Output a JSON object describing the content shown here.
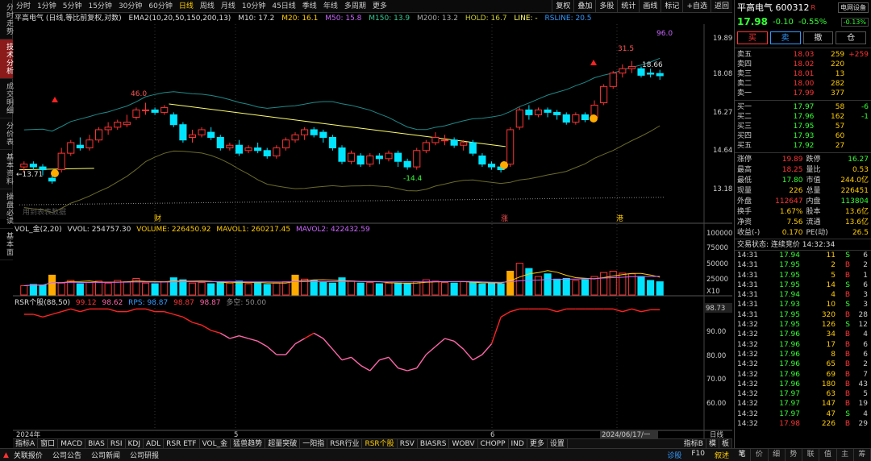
{
  "left_tabs": [
    "分时走势",
    "技术分析",
    "成交明细",
    "分价表",
    "基本资料",
    "操盘必读",
    "基本面"
  ],
  "periods": [
    "分时",
    "1分钟",
    "5分钟",
    "15分钟",
    "30分钟",
    "60分钟",
    "日线",
    "周线",
    "月线",
    "10分钟",
    "45日线",
    "季线",
    "年线",
    "多周期",
    "更多"
  ],
  "active_period": "日线",
  "top_tools": [
    "复权",
    "叠加",
    "多股",
    "统计",
    "画线",
    "标记",
    "+自选",
    "返回"
  ],
  "info": {
    "title": "平高电气 (日线,等比前复权,对数)",
    "ema": "EMA2(10,20,50,150,200,13)",
    "m10": "M10: 17.2",
    "m20": "M20: 16.1",
    "m50": "M50: 15.8",
    "m150": "M150: 13.9",
    "m200": "M200: 13.2",
    "hold": "HOLD: 16.7",
    "line": "LINE: -",
    "rsline": "RSLINE: 20.5"
  },
  "price_axis": [
    "19.89",
    "18.08",
    "16.27",
    "14.64",
    "13.18"
  ],
  "annotations": {
    "a1": "←13.71",
    "a2": "46.0",
    "a3": "-14.4",
    "a4": "31.5",
    "a5": "96.0",
    "a6": "18.66",
    "wm": "用到表表数据"
  },
  "date_markers": [
    "财",
    "涨",
    "港"
  ],
  "vol_info": {
    "name": "VOL_金(2,20)",
    "vvol": "VVOL: 254757.30",
    "volume": "VOLUME: 226450.92",
    "mavol1": "MAVOL1: 260217.45",
    "mavol2": "MAVOL2: 422432.59"
  },
  "vol_axis": [
    "100000",
    "75000",
    "50000",
    "25000",
    "X10"
  ],
  "rsr_info": {
    "name": "RSR个股(88,50)",
    "v1": "99.12",
    "v2": "98.62",
    "rps": "RPS: 98.87",
    "v3": "98.87",
    "v4": "98.87",
    "kk": "多空: 50.00"
  },
  "rsr_axis": [
    "98.73",
    "90.00",
    "80.00",
    "70.00",
    "60.00"
  ],
  "x_axis": [
    "2024年",
    "5",
    "6",
    "2024/06/17/一",
    "日线"
  ],
  "ind_tabs": [
    "指标A",
    "窗口",
    "MACD",
    "BIAS",
    "RSI",
    "KDJ",
    "ADL",
    "RSR ETF",
    "VOL_金",
    "猛兽趋势",
    "超量突破",
    "一阳指",
    "RSR行业",
    "RSR个股",
    "RSV",
    "BIASRS",
    "WOBV",
    "CHOPP",
    "IND",
    "更多",
    "设置"
  ],
  "ind_right": [
    "指标B",
    "模",
    "板"
  ],
  "bottom_bar": [
    "关联报价",
    "公司公告",
    "公司新闻",
    "公司研报"
  ],
  "bottom_right": [
    "诊股",
    "F10",
    "叙述"
  ],
  "quote": {
    "name": "平高电气 600312",
    "tag": "R",
    "device": "电网设备",
    "price": "17.98",
    "change": "-0.10",
    "pct": "-0.55%",
    "rel": "-0.13%",
    "buttons": [
      "买",
      "卖",
      "撤",
      "仓"
    ],
    "asks": [
      {
        "l": "卖五",
        "p": "18.03",
        "q": "259",
        "d": "+259"
      },
      {
        "l": "卖四",
        "p": "18.02",
        "q": "220",
        "d": ""
      },
      {
        "l": "卖三",
        "p": "18.01",
        "q": "13",
        "d": ""
      },
      {
        "l": "卖二",
        "p": "18.00",
        "q": "282",
        "d": ""
      },
      {
        "l": "卖一",
        "p": "17.99",
        "q": "377",
        "d": ""
      }
    ],
    "bids": [
      {
        "l": "买一",
        "p": "17.97",
        "q": "58",
        "d": "-6"
      },
      {
        "l": "买二",
        "p": "17.96",
        "q": "162",
        "d": "-1"
      },
      {
        "l": "买三",
        "p": "17.95",
        "q": "57",
        "d": ""
      },
      {
        "l": "买四",
        "p": "17.93",
        "q": "60",
        "d": ""
      },
      {
        "l": "买五",
        "p": "17.92",
        "q": "27",
        "d": ""
      }
    ],
    "stats": [
      [
        "涨停",
        "19.89",
        "跌停",
        "16.27"
      ],
      [
        "最高",
        "18.25",
        "量比",
        "0.53"
      ],
      [
        "最低",
        "17.80",
        "市值",
        "244.0亿"
      ],
      [
        "现量",
        "226",
        "总量",
        "226451"
      ],
      [
        "外盘",
        "112647",
        "内盘",
        "113804"
      ],
      [
        "换手",
        "1.67%",
        "股本",
        "13.6亿"
      ],
      [
        "净资",
        "7.56",
        "流通",
        "13.6亿"
      ],
      [
        "收益(-)",
        "0.170",
        "PE(动)",
        "26.5"
      ]
    ],
    "status_label": "交易状态: 连续竞价 14:32:34",
    "ticks": [
      [
        "14:31",
        "17.94",
        "11",
        "S",
        "6"
      ],
      [
        "14:31",
        "17.95",
        "2",
        "B",
        "2"
      ],
      [
        "14:31",
        "17.95",
        "5",
        "B",
        "1"
      ],
      [
        "14:31",
        "17.95",
        "14",
        "S",
        "6"
      ],
      [
        "14:31",
        "17.94",
        "4",
        "B",
        "3"
      ],
      [
        "14:31",
        "17.93",
        "10",
        "S",
        "3"
      ],
      [
        "14:31",
        "17.95",
        "320",
        "B",
        "28"
      ],
      [
        "14:32",
        "17.95",
        "126",
        "S",
        "12"
      ],
      [
        "14:32",
        "17.96",
        "34",
        "B",
        "4"
      ],
      [
        "14:32",
        "17.96",
        "17",
        "B",
        "6"
      ],
      [
        "14:32",
        "17.96",
        "8",
        "B",
        "6"
      ],
      [
        "14:32",
        "17.96",
        "65",
        "B",
        "2"
      ],
      [
        "14:32",
        "17.96",
        "69",
        "B",
        "7"
      ],
      [
        "14:32",
        "17.96",
        "180",
        "B",
        "43"
      ],
      [
        "14:32",
        "17.97",
        "63",
        "B",
        "5"
      ],
      [
        "14:32",
        "17.97",
        "147",
        "B",
        "19"
      ],
      [
        "14:32",
        "17.97",
        "47",
        "S",
        "4"
      ],
      [
        "14:32",
        "17.98",
        "226",
        "B",
        "29"
      ]
    ],
    "bottom_tabs": [
      "笔",
      "价",
      "细",
      "势",
      "联",
      "值",
      "主",
      "筹"
    ]
  },
  "colors": {
    "up": "#ff3333",
    "down": "#00e5ff",
    "ma_yellow": "#ffff66",
    "band": "#1e8a8a",
    "rsr": "#ff66aa"
  },
  "chart_data": {
    "type": "candlestick",
    "candles": [
      [
        14.3,
        14.4,
        14.1,
        14.5
      ],
      [
        14.4,
        14.3,
        14.2,
        14.5
      ],
      [
        14.3,
        14.2,
        14.0,
        14.4
      ],
      [
        13.9,
        13.8,
        13.71,
        14.1
      ],
      [
        14.2,
        14.8,
        14.1,
        15.0
      ],
      [
        14.8,
        15.2,
        14.7,
        15.3
      ],
      [
        15.1,
        15.0,
        14.9,
        15.4
      ],
      [
        15.0,
        15.3,
        14.9,
        15.5
      ],
      [
        15.3,
        15.7,
        15.2,
        15.8
      ],
      [
        15.7,
        15.8,
        15.5,
        16.0
      ],
      [
        15.8,
        16.0,
        15.7,
        16.1
      ],
      [
        15.9,
        16.0,
        15.8,
        16.3
      ],
      [
        16.2,
        16.5,
        16.1,
        16.6
      ],
      [
        16.5,
        16.5,
        16.3,
        16.8
      ],
      [
        16.5,
        16.4,
        16.3,
        16.6
      ],
      [
        16.4,
        16.6,
        16.3,
        16.7
      ],
      [
        16.3,
        15.9,
        15.8,
        16.4
      ],
      [
        15.9,
        15.3,
        15.2,
        16.0
      ],
      [
        15.4,
        15.5,
        15.2,
        15.7
      ],
      [
        15.5,
        15.7,
        15.4,
        15.8
      ],
      [
        15.6,
        15.4,
        15.3,
        15.8
      ],
      [
        15.4,
        15.0,
        14.9,
        15.5
      ],
      [
        15.0,
        15.1,
        14.9,
        15.2
      ],
      [
        15.1,
        14.8,
        14.7,
        15.3
      ],
      [
        14.9,
        15.0,
        14.8,
        15.1
      ],
      [
        15.0,
        14.9,
        14.8,
        15.2
      ],
      [
        14.9,
        14.7,
        14.6,
        15.0
      ],
      [
        14.7,
        15.0,
        14.6,
        15.1
      ],
      [
        15.0,
        15.3,
        14.9,
        15.4
      ],
      [
        15.3,
        15.5,
        15.2,
        15.6
      ],
      [
        15.5,
        15.7,
        15.3,
        15.8
      ],
      [
        15.7,
        15.5,
        15.4,
        15.8
      ],
      [
        15.6,
        15.4,
        15.2,
        15.7
      ],
      [
        15.4,
        15.0,
        14.9,
        15.5
      ],
      [
        15.0,
        14.5,
        14.4,
        15.1
      ],
      [
        14.5,
        14.8,
        14.4,
        14.9
      ],
      [
        14.7,
        14.4,
        14.3,
        14.8
      ],
      [
        14.4,
        14.7,
        14.3,
        14.8
      ],
      [
        14.7,
        14.6,
        14.4,
        14.8
      ],
      [
        14.6,
        14.8,
        14.5,
        14.9
      ],
      [
        14.8,
        14.5,
        14.3,
        14.9
      ],
      [
        14.5,
        14.3,
        14.2,
        14.6
      ],
      [
        14.3,
        14.9,
        14.2,
        15.0
      ],
      [
        14.9,
        15.2,
        14.8,
        15.3
      ],
      [
        15.2,
        15.4,
        15.1,
        15.6
      ],
      [
        15.3,
        15.3,
        15.1,
        15.5
      ],
      [
        15.3,
        15.1,
        15.0,
        15.4
      ],
      [
        15.1,
        15.2,
        14.9,
        15.3
      ],
      [
        15.2,
        14.8,
        14.7,
        15.3
      ],
      [
        14.7,
        14.4,
        14.3,
        14.8
      ],
      [
        14.4,
        14.3,
        14.2,
        14.5
      ],
      [
        14.3,
        14.2,
        14.1,
        14.4
      ],
      [
        14.4,
        15.7,
        14.3,
        15.8
      ],
      [
        15.8,
        16.5,
        15.7,
        16.6
      ],
      [
        16.5,
        16.3,
        16.1,
        16.7
      ],
      [
        16.3,
        16.5,
        16.2,
        16.6
      ],
      [
        16.5,
        16.4,
        16.2,
        16.6
      ],
      [
        16.4,
        16.3,
        16.1,
        16.5
      ],
      [
        16.3,
        16.0,
        15.9,
        16.4
      ],
      [
        16.0,
        16.3,
        15.9,
        16.4
      ],
      [
        16.3,
        16.1,
        16.0,
        16.4
      ],
      [
        16.2,
        16.7,
        16.1,
        16.9
      ],
      [
        16.8,
        17.5,
        16.7,
        17.6
      ],
      [
        17.5,
        18.1,
        17.4,
        18.2
      ],
      [
        18.1,
        18.3,
        17.9,
        18.5
      ],
      [
        18.3,
        18.4,
        18.1,
        18.66
      ],
      [
        18.3,
        18.0,
        17.9,
        18.4
      ],
      [
        18.1,
        18.05,
        17.9,
        18.3
      ],
      [
        18.08,
        17.98,
        17.8,
        18.25
      ]
    ],
    "volumes": [
      14,
      16,
      15,
      30,
      18,
      22,
      17,
      19,
      21,
      18,
      22,
      20,
      25,
      18,
      17,
      20,
      26,
      23,
      18,
      19,
      17,
      20,
      18,
      21,
      17,
      19,
      16,
      18,
      20,
      30,
      24,
      22,
      19,
      18,
      26,
      21,
      18,
      19,
      17,
      18,
      18,
      17,
      20,
      23,
      21,
      19,
      18,
      20,
      19,
      17,
      18,
      17,
      36,
      48,
      40,
      28,
      32,
      24,
      25,
      22,
      23,
      28,
      34,
      36,
      33,
      32,
      28,
      22,
      20
    ]
  }
}
